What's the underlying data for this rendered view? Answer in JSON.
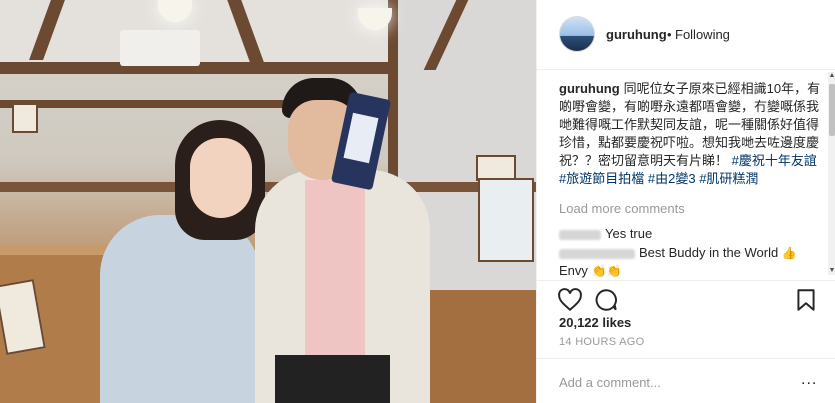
{
  "post": {
    "username": "guruhung",
    "follow_separator": "•",
    "follow_status": "Following",
    "caption": {
      "username": "guruhung",
      "text": "同呢位女子原來已經相識10年，有啲嘢會變，有啲嘢永遠都唔會變，冇變嘅係我哋難得嘅工作默契同友誼，呢一種關係好值得珍惜，點都要慶祝吓啦。想知我哋去咗邊度慶祝？？密切留意明天有片睇！",
      "hashtags": [
        "#慶祝十年友誼",
        "#旅遊節目拍檔",
        "#由2變3",
        "#肌研糕潤"
      ]
    },
    "load_more": "Load more comments",
    "comments": [
      {
        "text": "Yes true",
        "emoji": ""
      },
      {
        "text": "Best Buddy in the World",
        "emoji": "👍"
      },
      {
        "text": "Envy",
        "emoji": "👏👏"
      }
    ],
    "likes": "20,122 likes",
    "time": "14 HOURS AGO",
    "add_comment_placeholder": "Add a comment...",
    "more_options": "..."
  },
  "icons": {
    "like": "heart-icon",
    "comment": "speech-bubble-icon",
    "save": "bookmark-icon"
  },
  "colors": {
    "hashtag": "#003569",
    "muted": "#999999",
    "text": "#262626"
  }
}
